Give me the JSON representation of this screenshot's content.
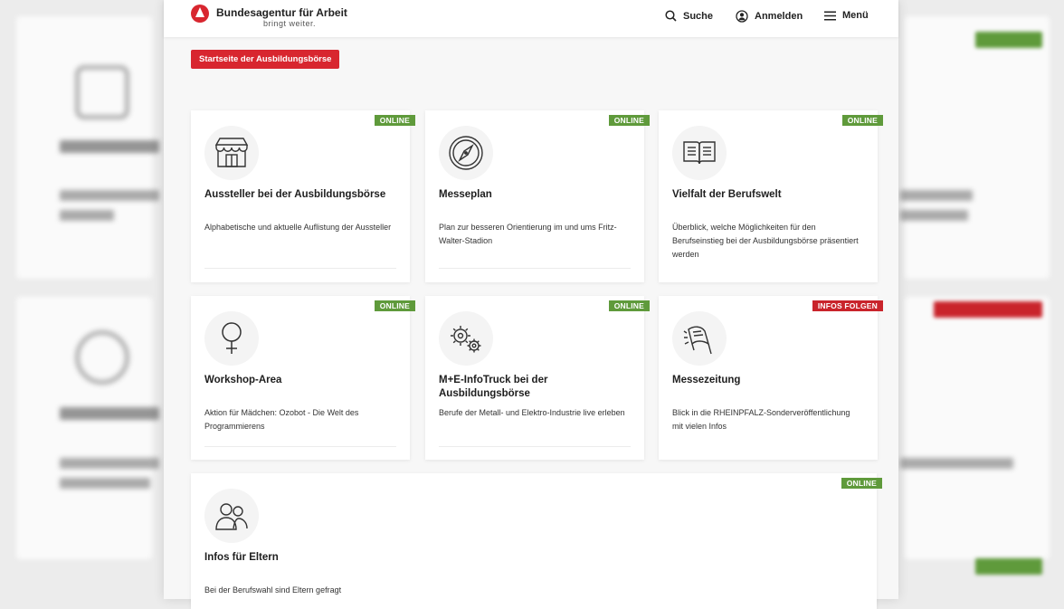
{
  "header": {
    "logo_title": "Bundesagentur für Arbeit",
    "logo_slogan": "bringt weiter.",
    "nav": [
      {
        "label": "Suche",
        "icon": "search-icon"
      },
      {
        "label": "Anmelden",
        "icon": "user-icon"
      },
      {
        "label": "Menü",
        "icon": "menu-icon"
      }
    ]
  },
  "home_button": "Startseite der Ausbildungsbörse",
  "colors": {
    "brand_red": "#d8262f",
    "online_green": "#5f9a3b",
    "info_red": "#c9242b"
  },
  "cards": [
    {
      "title": "Aussteller bei der Ausbildungsbörse",
      "desc": "Alphabetische und aktuelle Auflistung der Aussteller",
      "status": "ONLINE",
      "icon": "storefront-icon"
    },
    {
      "title": "Messeplan",
      "desc": "Plan zur besseren Orientierung im und ums Fritz-Walter-Stadion",
      "status": "ONLINE",
      "icon": "compass-icon"
    },
    {
      "title": "Vielfalt der Berufswelt",
      "desc": "Überblick, welche Möglichkeiten für den Berufseinstieg bei der Ausbildungsbörse präsentiert werden",
      "status": "ONLINE",
      "icon": "open-book-icon"
    },
    {
      "title": "Workshop-Area",
      "desc": "Aktion für Mädchen: Ozobot - Die Welt des Programmierens",
      "status": "ONLINE",
      "icon": "female-symbol-icon"
    },
    {
      "title": "M+E-InfoTruck bei der Ausbildungsbörse",
      "desc": "Berufe der Metall- und Elektro-Industrie live erleben",
      "status": "ONLINE",
      "icon": "gears-icon"
    },
    {
      "title": "Messezeitung",
      "desc": "Blick in die RHEINPFALZ-Sonderveröffentlichung mit vielen Infos",
      "status": "INFOS FOLGEN",
      "icon": "newspaper-icon"
    },
    {
      "title": "Infos für Eltern",
      "desc": "Bei der Berufswahl sind Eltern gefragt",
      "status": "ONLINE",
      "icon": "parents-icon"
    }
  ]
}
